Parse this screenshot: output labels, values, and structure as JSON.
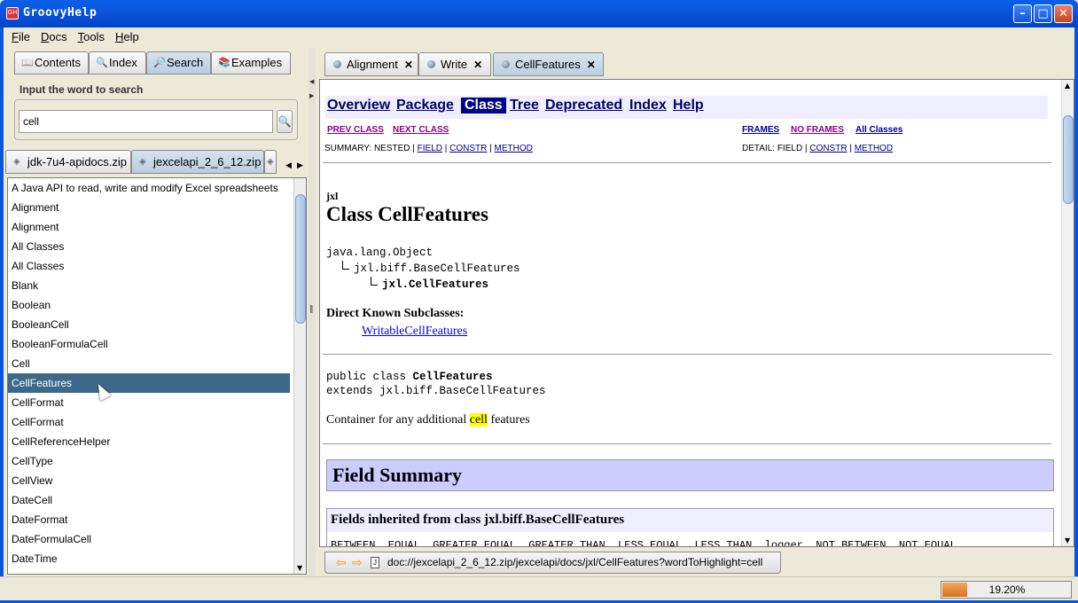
{
  "window": {
    "title": "GroovyHelp",
    "icon_text": "GH"
  },
  "menu": [
    "File",
    "Docs",
    "Tools",
    "Help"
  ],
  "left_tabs": [
    "Contents",
    "Index",
    "Search",
    "Examples"
  ],
  "search": {
    "label": "Input the word to search",
    "value": "cell"
  },
  "zip_tabs": [
    "jdk-7u4-apidocs.zip",
    "jexcelapi_2_6_12.zip"
  ],
  "results": [
    "A Java API to read, write and modify Excel spreadsheets",
    "Alignment",
    "Alignment",
    "All Classes",
    "All Classes",
    "Blank",
    "Boolean",
    "BooleanCell",
    "BooleanFormulaCell",
    "Cell",
    "CellFeatures",
    "CellFormat",
    "CellFormat",
    "CellReferenceHelper",
    "CellType",
    "CellView",
    "DateCell",
    "DateFormat",
    "DateFormulaCell",
    "DateTime"
  ],
  "selected_result": "CellFeatures",
  "doc_tabs": [
    "Alignment",
    "Write",
    "CellFeatures"
  ],
  "doc": {
    "nav": [
      "Overview",
      "Package",
      "Class",
      "Tree",
      "Deprecated",
      "Index",
      "Help"
    ],
    "prev_class": "PREV CLASS",
    "next_class": "NEXT CLASS",
    "frames": "FRAMES",
    "no_frames": "NO FRAMES",
    "all_classes": "All Classes",
    "summary_prefix": "SUMMARY: NESTED | ",
    "detail_prefix": "DETAIL: FIELD | ",
    "field": "FIELD",
    "constr": "CONSTR",
    "method": "METHOD",
    "package": "jxl",
    "class_title": "Class CellFeatures",
    "hierarchy": [
      "java.lang.Object",
      "jxl.biff.BaseCellFeatures",
      "jxl.CellFeatures"
    ],
    "subclasses_label": "Direct Known Subclasses:",
    "subclass": "WritableCellFeatures",
    "decl_line1_a": "public class ",
    "decl_line1_b": "CellFeatures",
    "decl_line2": "extends jxl.biff.BaseCellFeatures",
    "desc_before": "Container for any additional ",
    "desc_highlight": "cell",
    "desc_after": " features",
    "field_summary": "Field Summary",
    "fields_inherited": "Fields inherited from class jxl.biff.BaseCellFeatures",
    "fields_values": "BETWEEN, EQUAL, GREATER_EQUAL, GREATER_THAN, LESS_EQUAL, LESS_THAN, logger, NOT_BETWEEN, NOT_EQUAL"
  },
  "address": "doc://jexcelapi_2_6_12.zip/jexcelapi/docs/jxl/CellFeatures?wordToHighlight=cell",
  "progress": {
    "value": 19.2,
    "label": "19.20%"
  }
}
